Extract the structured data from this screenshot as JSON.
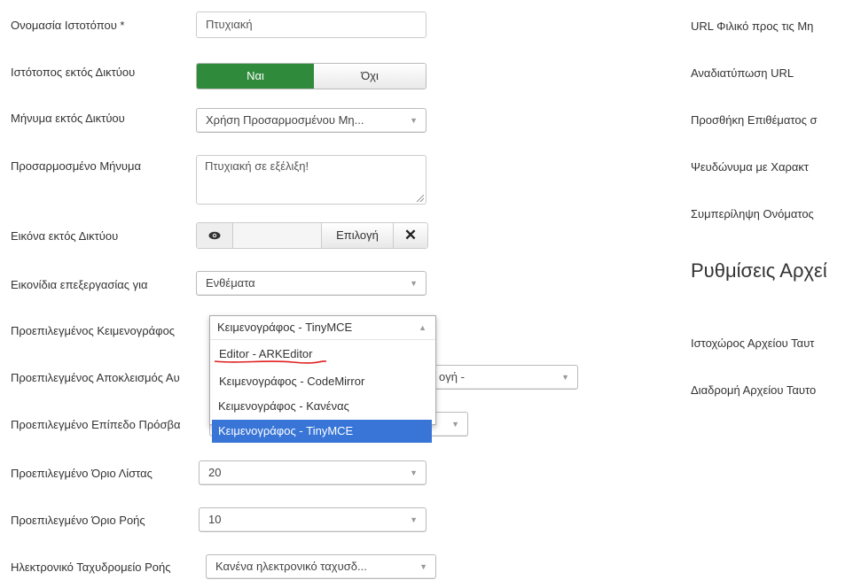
{
  "form": {
    "site_name": {
      "label": "Ονομασία Ιστοτόπου *",
      "value": "Πτυχιακή"
    },
    "site_offline": {
      "label": "Ιστότοπος εκτός Δικτύου",
      "yes": "Ναι",
      "no": "Όχι",
      "selected": "Ναι",
      "accent": "#2f8a3b"
    },
    "offline_message": {
      "label": "Μήνυμα εκτός Δικτύου",
      "value": "Χρήση Προσαρμοσμένου Μη..."
    },
    "custom_message": {
      "label": "Προσαρμοσμένο Μήνυμα",
      "value": "Πτυχιακή σε εξέλιξη!"
    },
    "offline_image": {
      "label": "Εικόνα εκτός Δικτύου",
      "select_label": "Επιλογή",
      "eye_icon": "eye-icon",
      "clear_icon": "close-icon"
    },
    "edit_icons": {
      "label": "Εικονίδια επεξεργασίας για",
      "value": "Ενθέματα"
    },
    "default_editor": {
      "label": "Προεπιλεγμένος Κειμενογράφος",
      "value": "Κειμενογράφος - TinyMCE"
    },
    "default_captcha": {
      "label": "Προεπιλεγμένος Αποκλεισμός Αυ",
      "value_tail": "ογή -"
    },
    "default_access": {
      "label": "Προεπιλεγμένο Επίπεδο Πρόσβα"
    },
    "default_list_limit": {
      "label": "Προεπιλεγμένο Όριο Λίστας",
      "value": "20"
    },
    "default_feed_limit": {
      "label": "Προεπιλεγμένο Όριο Ροής",
      "value": "10"
    },
    "feed_email": {
      "label": "Ηλεκτρονικό Ταχυδρομείο Ροής",
      "value": "Κανένα ηλεκτρονικό ταχυσδ..."
    }
  },
  "editor_dropdown": {
    "options": [
      "Editor - ARKEditor",
      "Κειμενογράφος - CodeMirror",
      "Κειμενογράφος - Κανένας",
      "Κειμενογράφος - TinyMCE"
    ],
    "selected": "Κειμενογράφος - TinyMCE",
    "highlight_color": "#3875d7",
    "annotation_color": "#e02020"
  },
  "right_column": {
    "labels": [
      "URL Φιλικό προς τις Μη",
      "Αναδιατύπωση URL",
      "Προσθήκη Επιθέματος σ",
      "Ψευδώνυμα με Χαρακτ",
      "Συμπερίληψη Ονόματος"
    ],
    "section_title": "Ρυθμίσεις Αρχεί",
    "lower_labels": [
      "Ιστοχώρος Αρχείου Ταυτ",
      "Διαδρομή Αρχείου Ταυτο"
    ]
  }
}
